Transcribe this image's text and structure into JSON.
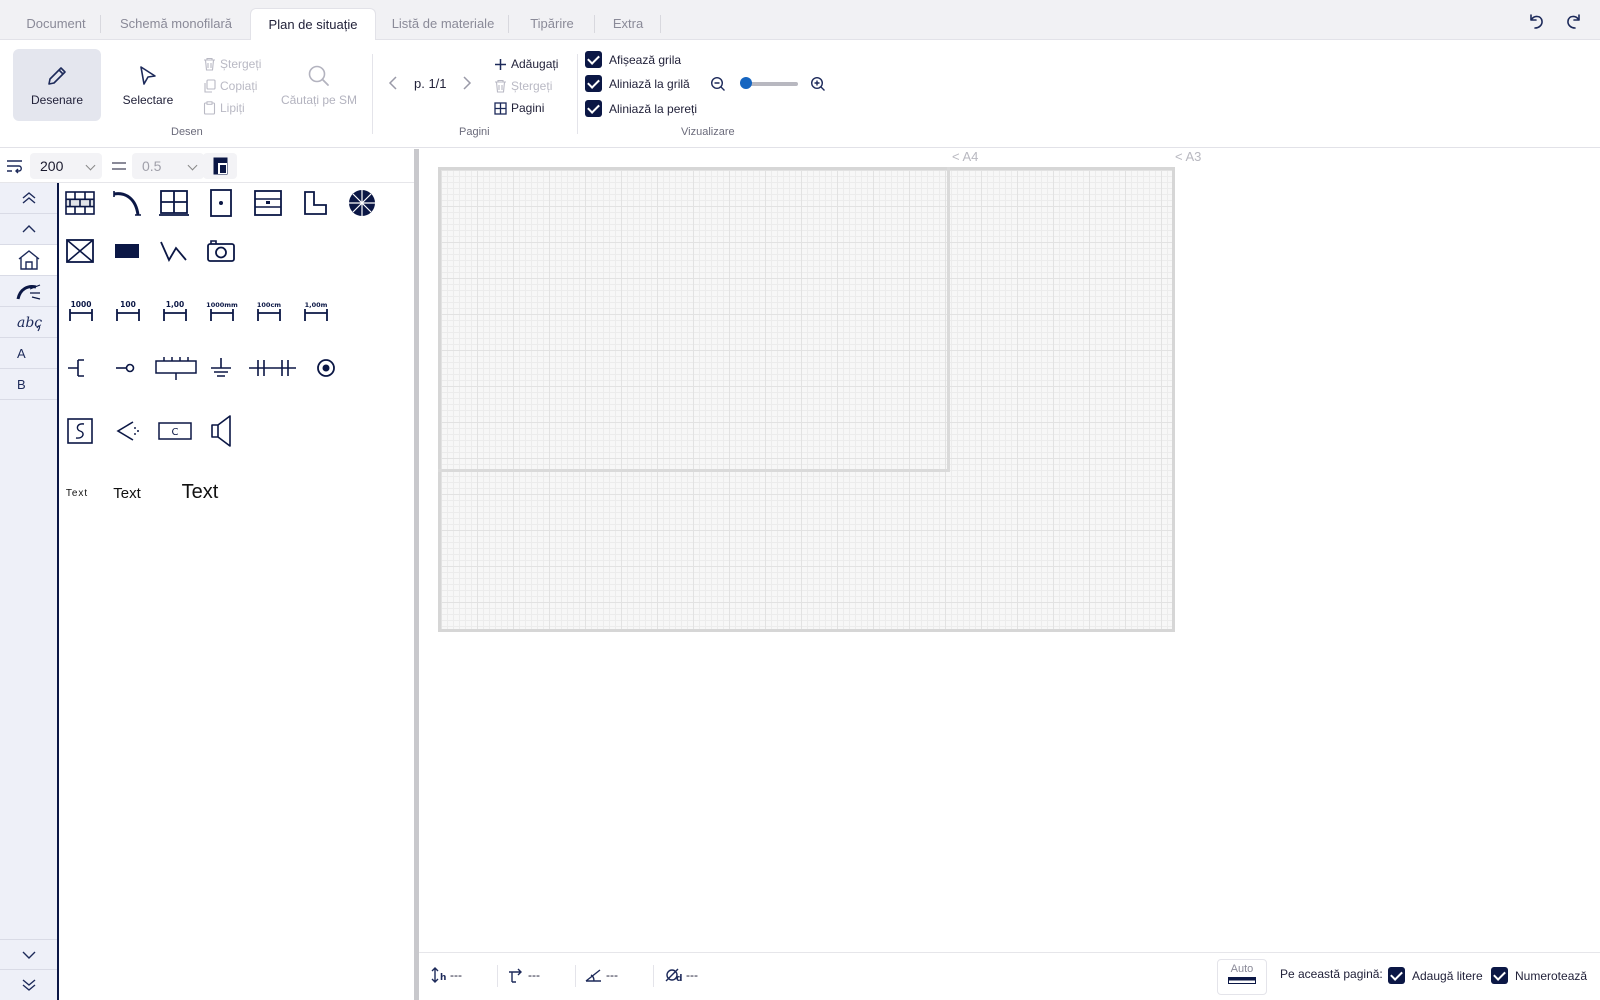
{
  "tabs": [
    {
      "label": "Document"
    },
    {
      "label": "Schemă monofilară"
    },
    {
      "label": "Plan de situație"
    },
    {
      "label": "Listă de materiale"
    },
    {
      "label": "Tipărire"
    },
    {
      "label": "Extra"
    }
  ],
  "ribbon": {
    "desen": {
      "group_label": "Desen",
      "draw_label": "Desenare",
      "select_label": "Selectare",
      "delete_label": "Ștergeți",
      "copy_label": "Copiați",
      "paste_label": "Lipiți",
      "search_label": "Căutați pe SM"
    },
    "pagini": {
      "group_label": "Pagini",
      "page_indicator": "p. 1/1",
      "add_label": "Adăugați",
      "delete_label": "Ștergeți",
      "pages_label": "Pagini"
    },
    "vizualizare": {
      "group_label": "Vizualizare",
      "show_grid": "Afișează grila",
      "snap_grid": "Aliniază la grilă",
      "snap_walls": "Aliniază la pereți",
      "zoom_level": 0.05
    }
  },
  "left_toolbar": {
    "size_value": "200",
    "line_width_value": "0.5"
  },
  "nav": {
    "letter_a": "A",
    "letter_b": "B"
  },
  "palette": {
    "scale_labels": [
      "1000",
      "100",
      "1,00",
      "1000mm",
      "100cm",
      "1,00m"
    ],
    "meter_c_label": "C",
    "text_small": "Text",
    "text_medium": "Text",
    "text_large": "Text"
  },
  "canvas": {
    "label_a4": "< A4",
    "label_a3": "< A3"
  },
  "status": {
    "height_value": "---",
    "offset_value": "---",
    "angle_value": "---",
    "diameter_value": "---",
    "auto_label": "Auto",
    "page_label": "Pe această pagină:",
    "add_letters": "Adaugă litere",
    "numbering": "Numerotează"
  },
  "colors": {
    "accent_dark": "#0b1745",
    "zoom_knob": "#1565c0"
  }
}
